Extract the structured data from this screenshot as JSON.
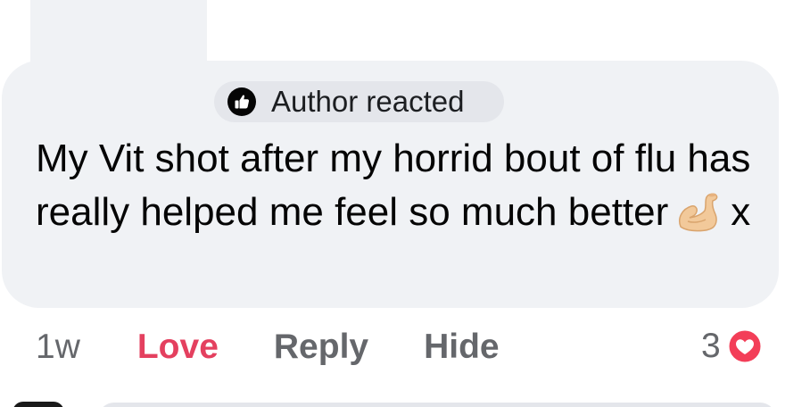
{
  "comment": {
    "reaction_badge": {
      "label": "Author reacted",
      "icon": "like-thumb-icon"
    },
    "text_main": "My Vit shot after my horrid bout of flu has really helped me feel so much better",
    "emoji": "flexed-biceps-icon",
    "text_end": "x"
  },
  "actions": {
    "time": "1w",
    "love": "Love",
    "reply": "Reply",
    "hide": "Hide"
  },
  "reactions": {
    "count": "3",
    "icon": "heart-reaction-icon"
  },
  "colors": {
    "bubble": "#f0f2f5",
    "love_accent": "#e4405f",
    "secondary_text": "#65676b",
    "primary_text": "#050505"
  }
}
